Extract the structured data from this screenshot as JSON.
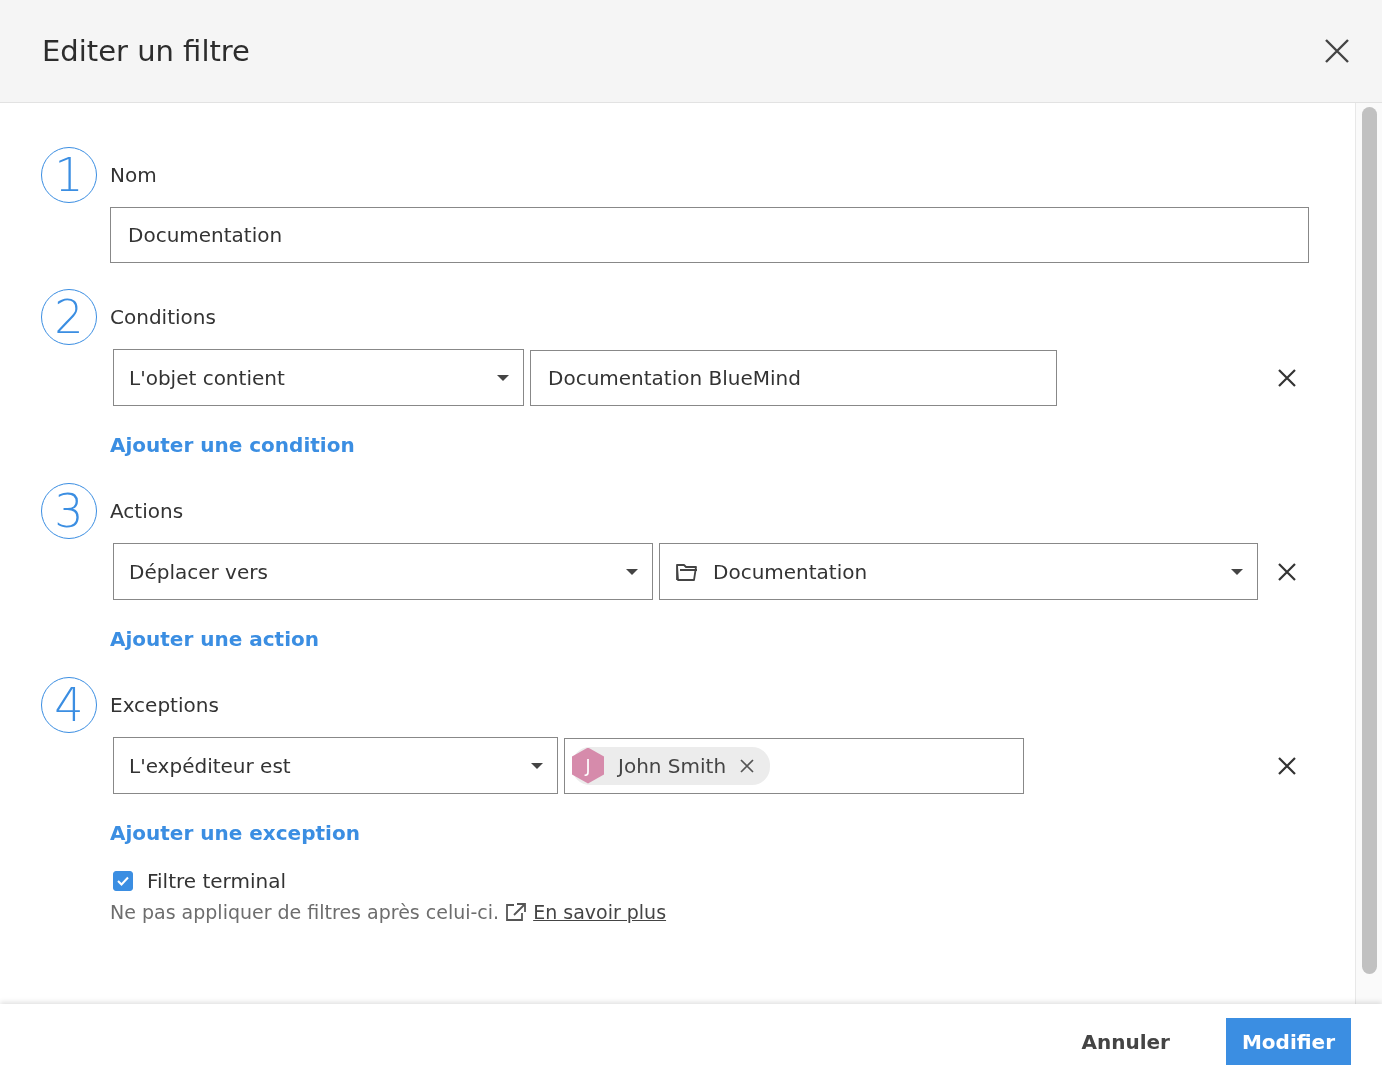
{
  "dialog": {
    "title": "Editer un filtre"
  },
  "steps": [
    {
      "number": "1",
      "label": "Nom",
      "kind": "name",
      "value": "Documentation"
    },
    {
      "number": "2",
      "label": "Conditions",
      "kind": "rules",
      "rows": [
        {
          "selector": "L'objet contient",
          "kind": "text",
          "value": "Documentation BlueMind"
        }
      ],
      "add_link": "Ajouter une condition"
    },
    {
      "number": "3",
      "label": "Actions",
      "kind": "rules",
      "rows": [
        {
          "selector": "Déplacer vers",
          "kind": "folder",
          "value": "Documentation"
        }
      ],
      "add_link": "Ajouter une action"
    },
    {
      "number": "4",
      "label": "Exceptions",
      "kind": "rules",
      "rows": [
        {
          "selector": "L'expéditeur est",
          "kind": "contacts",
          "contacts": [
            {
              "initial": "J",
              "name": "John Smith"
            }
          ]
        }
      ],
      "add_link": "Ajouter une exception"
    }
  ],
  "terminal": {
    "label": "Filtre terminal",
    "checked": true,
    "description": "Ne pas appliquer de filtres après celui-ci.",
    "link": "En savoir plus"
  },
  "buttons": [
    {
      "label": "Annuler",
      "kind": "secondary"
    },
    {
      "label": "Modifier",
      "kind": "primary"
    }
  ]
}
